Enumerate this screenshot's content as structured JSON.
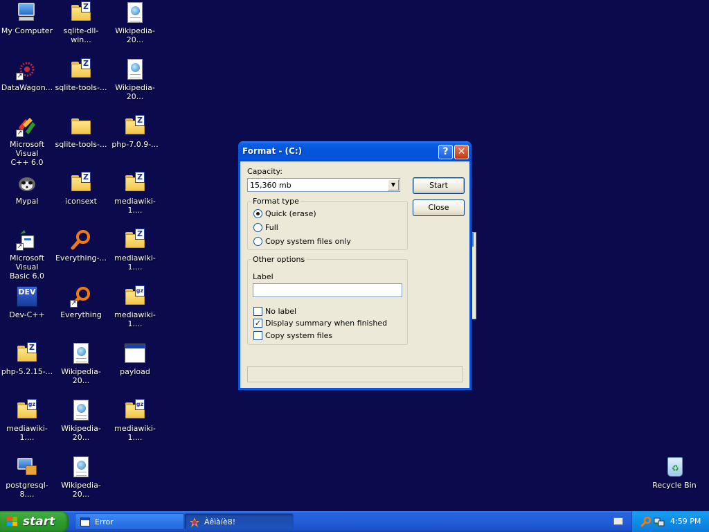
{
  "desktop": {
    "icons": [
      {
        "label": "My Computer"
      },
      {
        "label": "sqlite-dll-win..."
      },
      {
        "label": "Wikipedia-20..."
      },
      {
        "label": "DataWagon..."
      },
      {
        "label": "sqlite-tools-..."
      },
      {
        "label": "Wikipedia-20..."
      },
      {
        "label": "Microsoft Visual\nC++ 6.0"
      },
      {
        "label": "sqlite-tools-..."
      },
      {
        "label": "php-7.0.9-..."
      },
      {
        "label": "Mypal"
      },
      {
        "label": "iconsext"
      },
      {
        "label": "mediawiki-1...."
      },
      {
        "label": "Microsoft Visual\nBasic 6.0"
      },
      {
        "label": "Everything-..."
      },
      {
        "label": "mediawiki-1...."
      },
      {
        "label": "Dev-C++"
      },
      {
        "label": "Everything"
      },
      {
        "label": "mediawiki-1...."
      },
      {
        "label": "php-5.2.15-..."
      },
      {
        "label": "Wikipedia-20..."
      },
      {
        "label": "payload"
      },
      {
        "label": "mediawiki-1...."
      },
      {
        "label": "Wikipedia-20..."
      },
      {
        "label": "mediawiki-1...."
      },
      {
        "label": "postgresql-8...."
      },
      {
        "label": "Wikipedia-20..."
      },
      {
        "label": "Recycle Bin"
      }
    ],
    "zip_badge": "Z",
    "gz_badge": "gz",
    "dev_badge": "DEV"
  },
  "dialog": {
    "title": "Format -  (C:)",
    "help_glyph": "?",
    "close_glyph": "✕",
    "capacity_label": "Capacity:",
    "capacity_value": "15,360 mb",
    "combo_arrow": "▼",
    "start_label": "Start",
    "close_label": "Close",
    "format_type": {
      "title": "Format type",
      "options": [
        {
          "label": "Quick (erase)",
          "selected": true
        },
        {
          "label": "Full",
          "selected": false
        },
        {
          "label": "Copy system files only",
          "selected": false
        }
      ]
    },
    "other_options": {
      "title": "Other options",
      "label_caption": "Label",
      "label_value": "",
      "checks": [
        {
          "label": "No label",
          "checked": false
        },
        {
          "label": "Display summary when finished",
          "checked": true
        },
        {
          "label": "Copy system files",
          "checked": false
        }
      ],
      "check_glyph": "✓"
    }
  },
  "taskbar": {
    "start_label": "start",
    "tasks": [
      {
        "label": "Error",
        "active": false
      },
      {
        "label": "Àêìàíè8!",
        "active": true
      }
    ],
    "clock": "4:59 PM"
  },
  "colors": {
    "desktop_bg": "#0a0a4c",
    "title_blue": "#0453d8",
    "dialog_face": "#ece9d8",
    "start_green": "#2e9c2e",
    "tray_blue": "#0f8de6"
  }
}
